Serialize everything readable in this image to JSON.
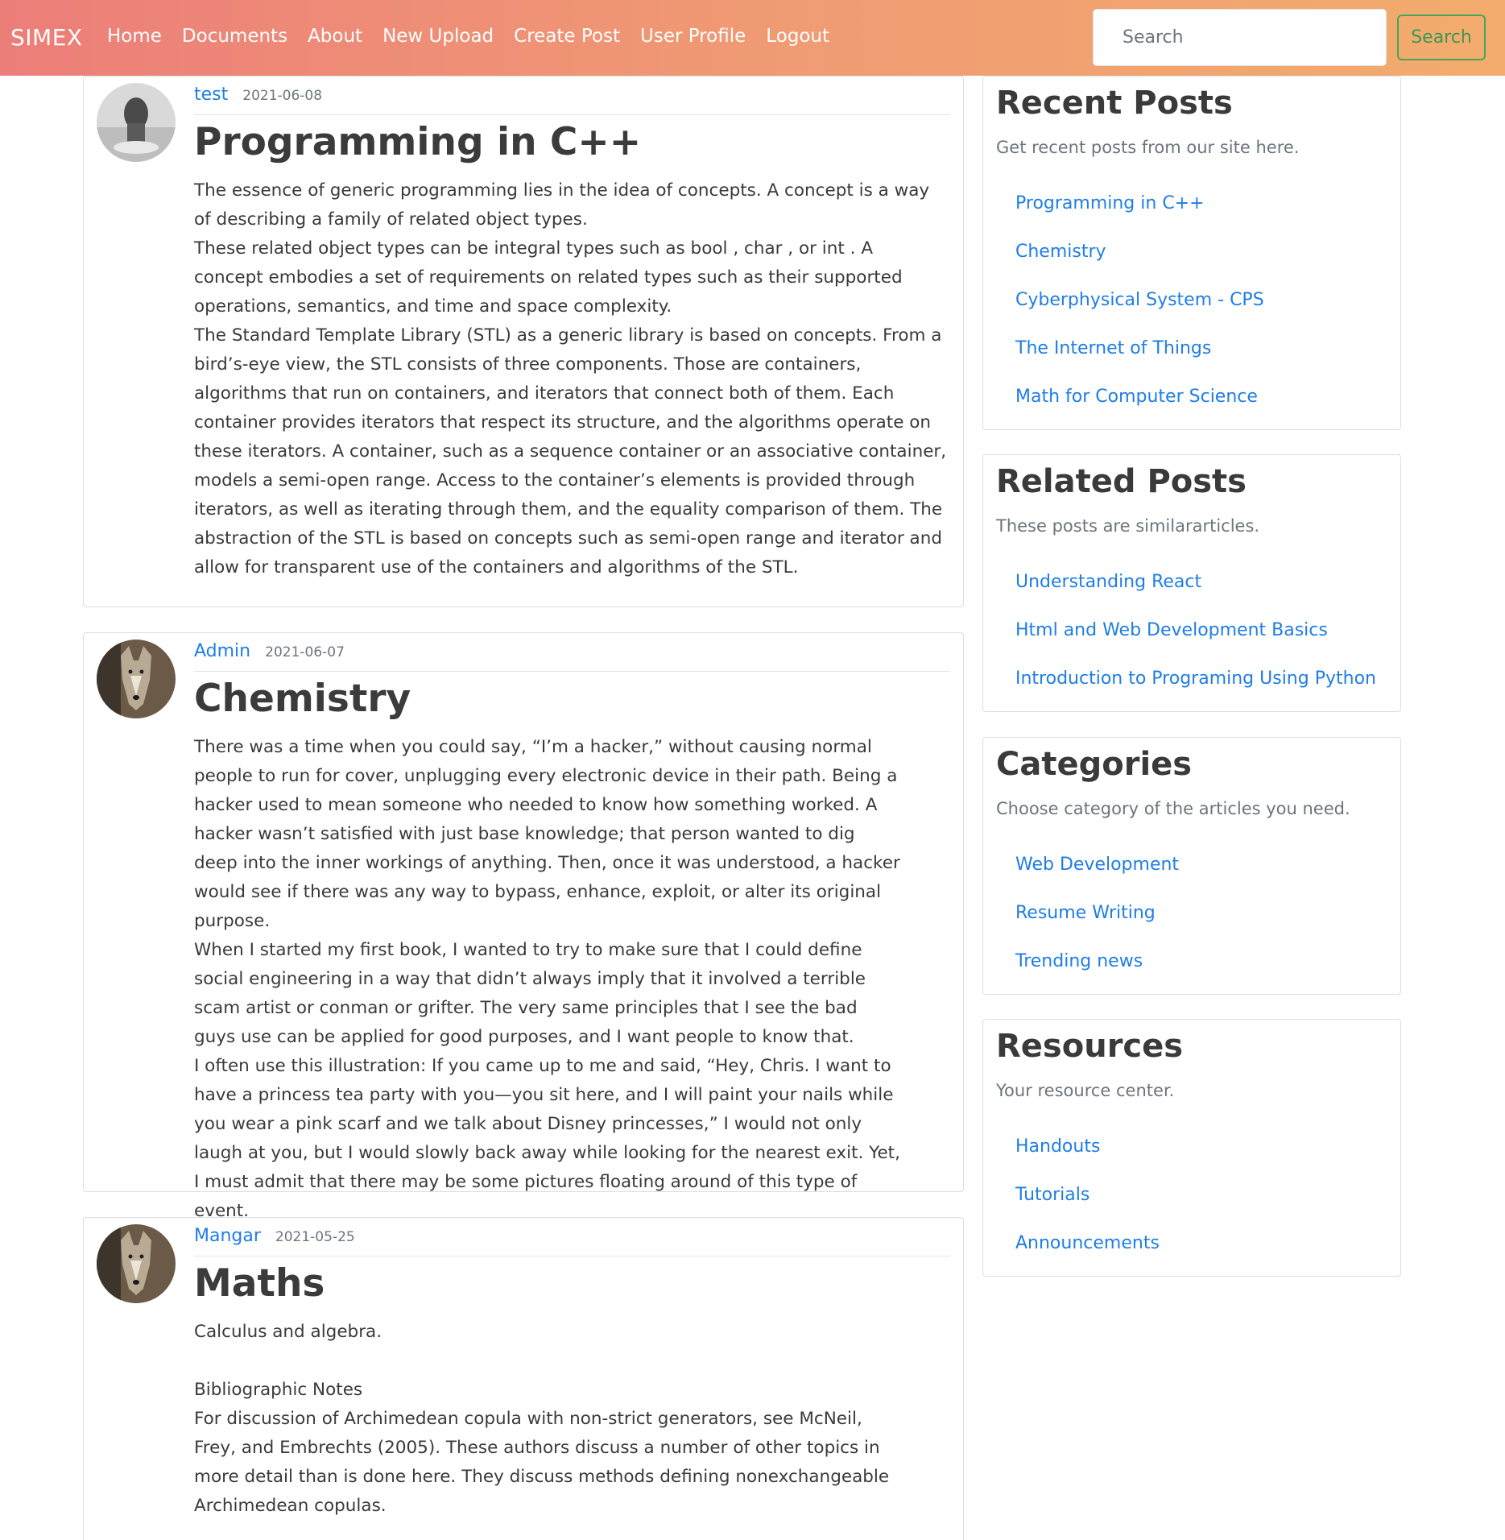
{
  "navbar": {
    "brand": "SIMEX",
    "links": [
      "Home",
      "Documents",
      "About",
      "New Upload",
      "Create Post",
      "User Profile",
      "Logout"
    ],
    "search_placeholder": "Search",
    "search_button": "Search"
  },
  "posts": [
    {
      "author": "test",
      "date": "2021-06-08",
      "title": "Programming in C++",
      "body": [
        "The essence of generic programming lies in the idea of concepts. A concept is a way of describing a family of related object types.",
        "These related object types can be integral types such as bool , char , or int . A concept embodies a set of requirements on related types such as their supported operations, semantics, and time and space complexity.",
        "The Standard Template Library (STL) as a generic library is based on concepts. From a bird’s-eye view, the STL consists of three components. Those are containers, algorithms that run on containers, and iterators that connect both of them. Each container provides iterators that respect its structure, and the algorithms operate on these iterators. A container, such as a sequence container or an associative container, models a semi-open range. Access to the container’s elements is provided through iterators, as well as iterating through them, and the equality comparison of them. The abstraction of the STL is based on concepts such as semi-open range and iterator and allow for transparent use of the containers and algorithms of the STL."
      ]
    },
    {
      "author": "Admin",
      "date": "2021-06-07",
      "title": "Chemistry",
      "body": [
        "There was a time when you could say, “I’m a hacker,” without causing normal people to run for cover, unplugging every electronic device in their path. Being a hacker used to mean someone who needed to know how something worked. A hacker wasn’t satisfied with just base knowledge; that person wanted to dig deep into the inner workings of anything. Then, once it was understood, a hacker would see if there was any way to bypass, enhance, exploit, or alter its original purpose.",
        "When I started my first book, I wanted to try to make sure that I could define social engineering in a way that didn’t always imply that it involved a terrible scam artist or conman or grifter. The very same principles that I see the bad guys use can be applied for good purposes, and I want people to know that.",
        "I often use this illustration: If you came up to me and said, “Hey, Chris. I want to have a princess tea party with you—you sit here, and I will paint your nails while you wear a pink scarf and we talk about Disney princesses,” I would not only laugh at you, but I would slowly back away while looking for the nearest exit. Yet, I must admit that there may be some pictures floating around of this type of event."
      ]
    },
    {
      "author": "Mangar",
      "date": "2021-05-25",
      "title": "Maths",
      "body": [
        "Calculus and algebra.",
        "",
        "Bibliographic Notes",
        "For discussion of Archimedean copula with non-strict generators, see McNeil, Frey, and Embrechts (2005). These authors discuss a number of other topics in more detail than is done here. They discuss methods defining nonexchangeable Archimedean copulas."
      ]
    }
  ],
  "sidebar": [
    {
      "title": "Recent Posts",
      "subtitle": "Get recent posts from our site here.",
      "items": [
        "Programming in C++",
        "Chemistry",
        "Cyberphysical System - CPS",
        "The Internet of Things",
        "Math for Computer Science"
      ]
    },
    {
      "title": "Related Posts",
      "subtitle": "These posts are similararticles.",
      "items": [
        "Understanding React",
        "Html and Web Development Basics",
        "Introduction to Programing Using Python"
      ]
    },
    {
      "title": "Categories",
      "subtitle": "Choose category of the articles you need.",
      "items": [
        "Web Development",
        "Resume Writing",
        "Trending news"
      ]
    },
    {
      "title": "Resources",
      "subtitle": "Your resource center.",
      "items": [
        "Handouts",
        "Tutorials",
        "Announcements"
      ]
    }
  ]
}
